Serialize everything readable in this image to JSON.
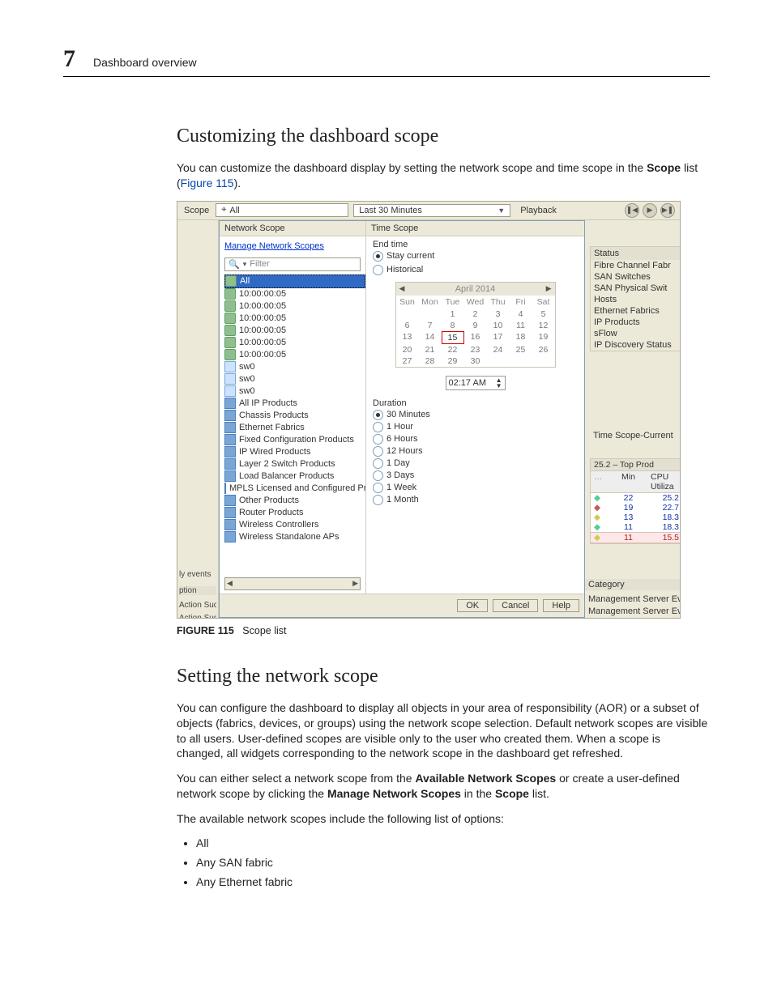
{
  "header": {
    "chapter_number": "7",
    "chapter_title": "Dashboard overview"
  },
  "section1": {
    "heading": "Customizing the dashboard scope",
    "para_pre": "You can customize the dashboard display by setting the network scope and time scope in the ",
    "para_bold": "Scope",
    "para_mid": " list (",
    "figref": "Figure 115",
    "para_post": ")."
  },
  "figure_caption": {
    "label": "FIGURE 115",
    "text": "Scope list"
  },
  "section2": {
    "heading": "Setting the network scope",
    "p1": "You can configure the dashboard to display all objects in your area of responsibility (AOR) or a subset of objects (fabrics, devices, or groups) using the network scope selection. Default network scopes are visible to all users. User-defined scopes are visible only to the user who created them. When a scope is changed, all widgets corresponding to the network scope in the dashboard get refreshed.",
    "p2_a": "You can either select a network scope from the ",
    "p2_b1": "Available Network Scopes",
    "p2_b": " or create a user-defined network scope by clicking the ",
    "p2_b2": "Manage Network Scopes",
    "p2_c": " in the ",
    "p2_b3": "Scope",
    "p2_d": " list.",
    "p3": "The available network scopes include the following list of options:",
    "bullets": [
      "All",
      "Any SAN fabric",
      "Any Ethernet fabric"
    ]
  },
  "screenshot": {
    "topbar": {
      "scope_label": "Scope",
      "all_value": "All",
      "last30": "Last 30 Minutes",
      "playback": "Playback"
    },
    "leftedge": {
      "events": "ly events",
      "ption": "ption",
      "a1": "Action Suc",
      "a2": "Action Suc"
    },
    "dropdown": {
      "left_head": "Network Scope",
      "manage_link": "Manage Network Scopes",
      "filter_placeholder": "Filter",
      "tree": [
        {
          "label": "All",
          "icon": "fabric",
          "selected": true
        },
        {
          "label": "10:00:00:05",
          "icon": "fabric"
        },
        {
          "label": "10:00:00:05",
          "icon": "fabric"
        },
        {
          "label": "10:00:00:05",
          "icon": "fabric"
        },
        {
          "label": "10:00:00:05",
          "icon": "fabric"
        },
        {
          "label": "10:00:00:05",
          "icon": "fabric"
        },
        {
          "label": "10:00:00:05",
          "icon": "fabric"
        },
        {
          "label": "sw0",
          "icon": "sw"
        },
        {
          "label": "sw0",
          "icon": "sw"
        },
        {
          "label": "sw0",
          "icon": "sw"
        },
        {
          "label": "All IP Products",
          "icon": "ip"
        },
        {
          "label": "Chassis Products",
          "icon": "ip"
        },
        {
          "label": "Ethernet Fabrics",
          "icon": "ip"
        },
        {
          "label": "Fixed Configuration Products",
          "icon": "ip"
        },
        {
          "label": "IP Wired Products",
          "icon": "ip"
        },
        {
          "label": "Layer 2 Switch Products",
          "icon": "ip"
        },
        {
          "label": "Load Balancer Products",
          "icon": "ip"
        },
        {
          "label": "MPLS Licensed and Configured Pro",
          "icon": "ip"
        },
        {
          "label": "Other Products",
          "icon": "ip"
        },
        {
          "label": "Router Products",
          "icon": "ip"
        },
        {
          "label": "Wireless Controllers",
          "icon": "ip"
        },
        {
          "label": "Wireless Standalone APs",
          "icon": "ip"
        }
      ],
      "right_head": "Time Scope",
      "end_time": "End time",
      "stay_current": "Stay current",
      "historical": "Historical",
      "cal_month": "April 2014",
      "dows": [
        "Sun",
        "Mon",
        "Tue",
        "Wed",
        "Thu",
        "Fri",
        "Sat"
      ],
      "days": [
        "",
        "",
        "1",
        "2",
        "3",
        "4",
        "5",
        "6",
        "7",
        "8",
        "9",
        "10",
        "11",
        "12",
        "13",
        "14",
        "15",
        "16",
        "17",
        "18",
        "19",
        "20",
        "21",
        "22",
        "23",
        "24",
        "25",
        "26",
        "27",
        "28",
        "29",
        "30",
        "",
        "",
        ""
      ],
      "today_index": 16,
      "time_value": "02:17 AM",
      "duration_label": "Duration",
      "durations": [
        "30 Minutes",
        "1 Hour",
        "6 Hours",
        "12 Hours",
        "1 Day",
        "3 Days",
        "1 Week",
        "1 Month"
      ],
      "duration_selected": 0,
      "ok": "OK",
      "cancel": "Cancel",
      "help": "Help"
    },
    "right": {
      "status_head": "Status",
      "status_rows": [
        "Fibre Channel Fabr",
        "SAN Switches",
        "SAN Physical Swit",
        "Hosts",
        "Ethernet Fabrics",
        "IP Products",
        "sFlow",
        "IP Discovery Status"
      ],
      "time_scope": "Time Scope-Current",
      "table_head": "25.2 – Top Prod",
      "col1": "Min",
      "col2": "CPU Utiliza",
      "rows": [
        {
          "k": "22",
          "v": "25.2"
        },
        {
          "k": "19",
          "v": "22.7"
        },
        {
          "k": "13",
          "v": "18.3"
        },
        {
          "k": "11",
          "v": "18.3"
        },
        {
          "k": "11",
          "v": "15.5"
        }
      ],
      "category": "Category",
      "srv1": "Management Server Ev",
      "srv2": "Management Server Ev"
    }
  }
}
